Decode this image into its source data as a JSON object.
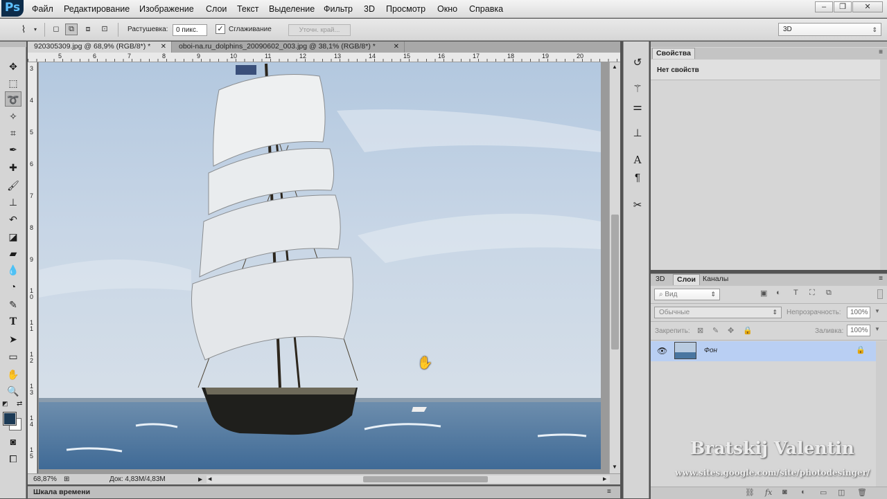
{
  "app": {
    "logo": "Ps"
  },
  "menu": [
    "Файл",
    "Редактирование",
    "Изображение",
    "Слои",
    "Текст",
    "Выделение",
    "Фильтр",
    "3D",
    "Просмотр",
    "Окно",
    "Справка"
  ],
  "options": {
    "feather_label": "Растушевка:",
    "feather_value": "0 пикс.",
    "antialias_label": "Сглаживание",
    "antialias_checked": true,
    "refine_edge": "Уточн. край...",
    "workspace": "3D"
  },
  "tabs": [
    {
      "label": "920305309.jpg @ 68,9% (RGB/8*) *",
      "active": true
    },
    {
      "label": "oboi-na.ru_dolphins_20090602_003.jpg @ 38,1% (RGB/8*) *",
      "active": false
    }
  ],
  "ruler_h": [
    "5",
    "6",
    "7",
    "8",
    "9",
    "10",
    "11",
    "12",
    "13",
    "14",
    "15",
    "16",
    "17",
    "18",
    "19",
    "20"
  ],
  "ruler_v": [
    "3",
    "4",
    "5",
    "6",
    "7",
    "8",
    "9",
    "1 0",
    "1 1",
    "1 2",
    "1 3",
    "1 4",
    "1 5"
  ],
  "status": {
    "zoom": "68,87%",
    "doc": "Док: 4,83M/4,83M"
  },
  "timeline": {
    "label": "Шкала времени"
  },
  "properties": {
    "tab": "Свойства",
    "empty_text": "Нет свойств"
  },
  "layers_panel": {
    "tabs": [
      "3D",
      "Слои",
      "Каналы"
    ],
    "active_tab": "Слои",
    "filter": "Вид",
    "blend_mode": "Обычные",
    "opacity_label": "Непрозрачность:",
    "opacity_value": "100%",
    "lock_label": "Закрепить:",
    "fill_label": "Заливка:",
    "fill_value": "100%",
    "layer_name": "Фон"
  },
  "watermark": {
    "name": "Bratskij Valentin",
    "url": "www.sites.google.com/site/photodesinger/"
  },
  "colors": {
    "fg": "#1c3a55",
    "bg": "#ffffff",
    "layer_selected": "#b9cff3"
  }
}
